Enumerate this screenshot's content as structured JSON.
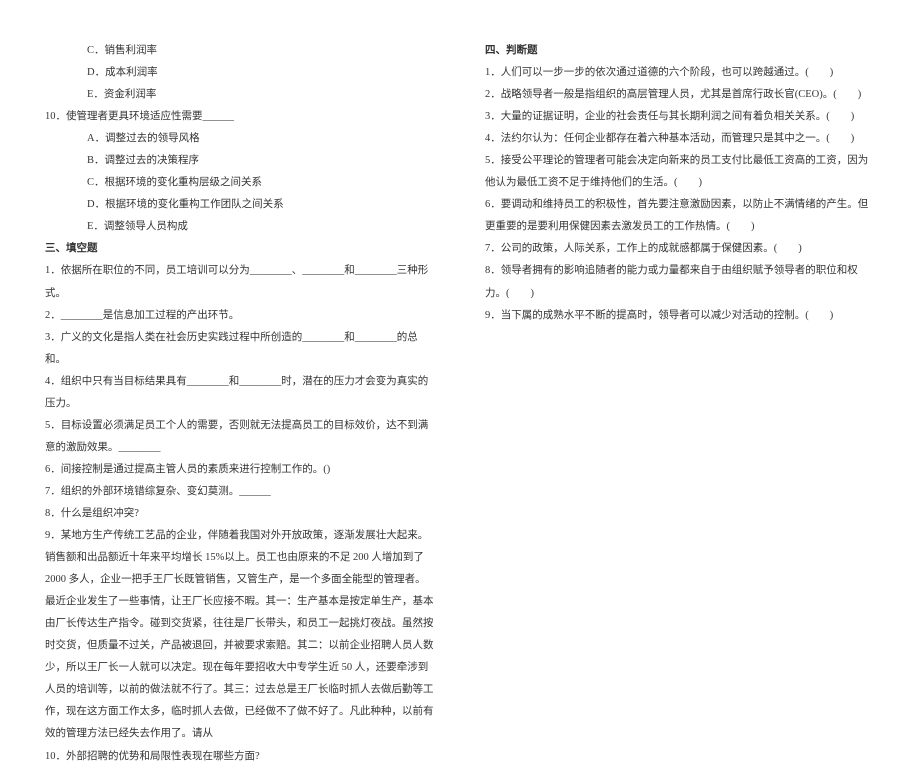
{
  "left": {
    "optC": "C．销售利润率",
    "optD": "D．成本利润率",
    "optE": "E．资金利润率",
    "q10": "10．使管理者更具环境适应性需要______",
    "q10a": "A．调整过去的领导风格",
    "q10b": "B．调整过去的决策程序",
    "q10c": "C．根据环境的变化重构层级之间关系",
    "q10d": "D．根据环境的变化重构工作团队之间关系",
    "q10e": "E．调整领导人员构成",
    "sec3": "三、填空题",
    "f1": "1．依据所在职位的不同，员工培训可以分为________、________和________三种形式。",
    "f2": "2．________是信息加工过程的产出环节。",
    "f3": "3．广义的文化是指人类在社会历史实践过程中所创造的________和________的总和。",
    "f4": "4．组织中只有当目标结果具有________和________时，潜在的压力才会变为真实的压力。",
    "f5": "5．目标设置必须满足员工个人的需要，否则就无法提高员工的目标效价，达不到满意的激励效果。________",
    "f6": "6．间接控制是通过提高主管人员的素质来进行控制工作的。()",
    "f7": "7．组织的外部环境错综复杂、变幻莫测。______",
    "f8": "8．什么是组织冲突?",
    "f9": "9．某地方生产传统工艺品的企业，伴随着我国对外开放政策，逐渐发展壮大起来。销售额和出品额近十年来平均增长 15%以上。员工也由原来的不足 200 人增加到了2000 多人，企业一把手王厂长既管销售，又管生产，是一个多面全能型的管理者。最近企业发生了一些事情，让王厂长应接不暇。其一：生产基本是按定单生产，基本由厂长传达生产指令。碰到交货紧，往往是厂长带头，和员工一起挑灯夜战。虽然按时交货，但质量不过关，产品被退回，并被要求索赔。其二：以前企业招聘人员人数少，所以王厂长一人就可以决定。现在每年要招收大中专学生近 50 人，还要牵涉到人员的培训等，以前的做法就不行了。其三：过去总是王厂长临时抓人去做后勤等工作，现在这方面工作太多，临时抓人去做，已经做不了做不好了。凡此种种，以前有效的管理方法已经失去作用了。请从",
    "f10": "10．外部招聘的优势和局限性表现在哪些方面?"
  },
  "right": {
    "sec4": "四、判断题",
    "j1": "1．人们可以一步一步的依次通过道德的六个阶段，也可以跨越通过。(　　)",
    "j2": "2．战略领导者一般是指组织的高层管理人员，尤其是首席行政长官(CEO)。(　　)",
    "j3": "3．大量的证据证明，企业的社会责任与其长期利润之间有着负相关关系。(　　)",
    "j4": "4．法约尔认为：任何企业都存在着六种基本活动，而管理只是其中之一。(　　)",
    "j5": "5．接受公平理论的管理者可能会决定向新来的员工支付比最低工资高的工资，因为他认为最低工资不足于维持他们的生活。(　　)",
    "j6": "6．要调动和维持员工的积极性，首先要注意激励因素，以防止不满情绪的产生。但更重要的是要利用保健因素去激发员工的工作热情。(　　)",
    "j7": "7．公司的政策，人际关系，工作上的成就感都属于保健因素。(　　)",
    "j8": "8．领导者拥有的影响追随者的能力或力量都来自于由组织赋予领导者的职位和权力。(　　)",
    "j9": "9．当下属的成熟水平不断的提高时，领导者可以减少对活动的控制。(　　)"
  }
}
